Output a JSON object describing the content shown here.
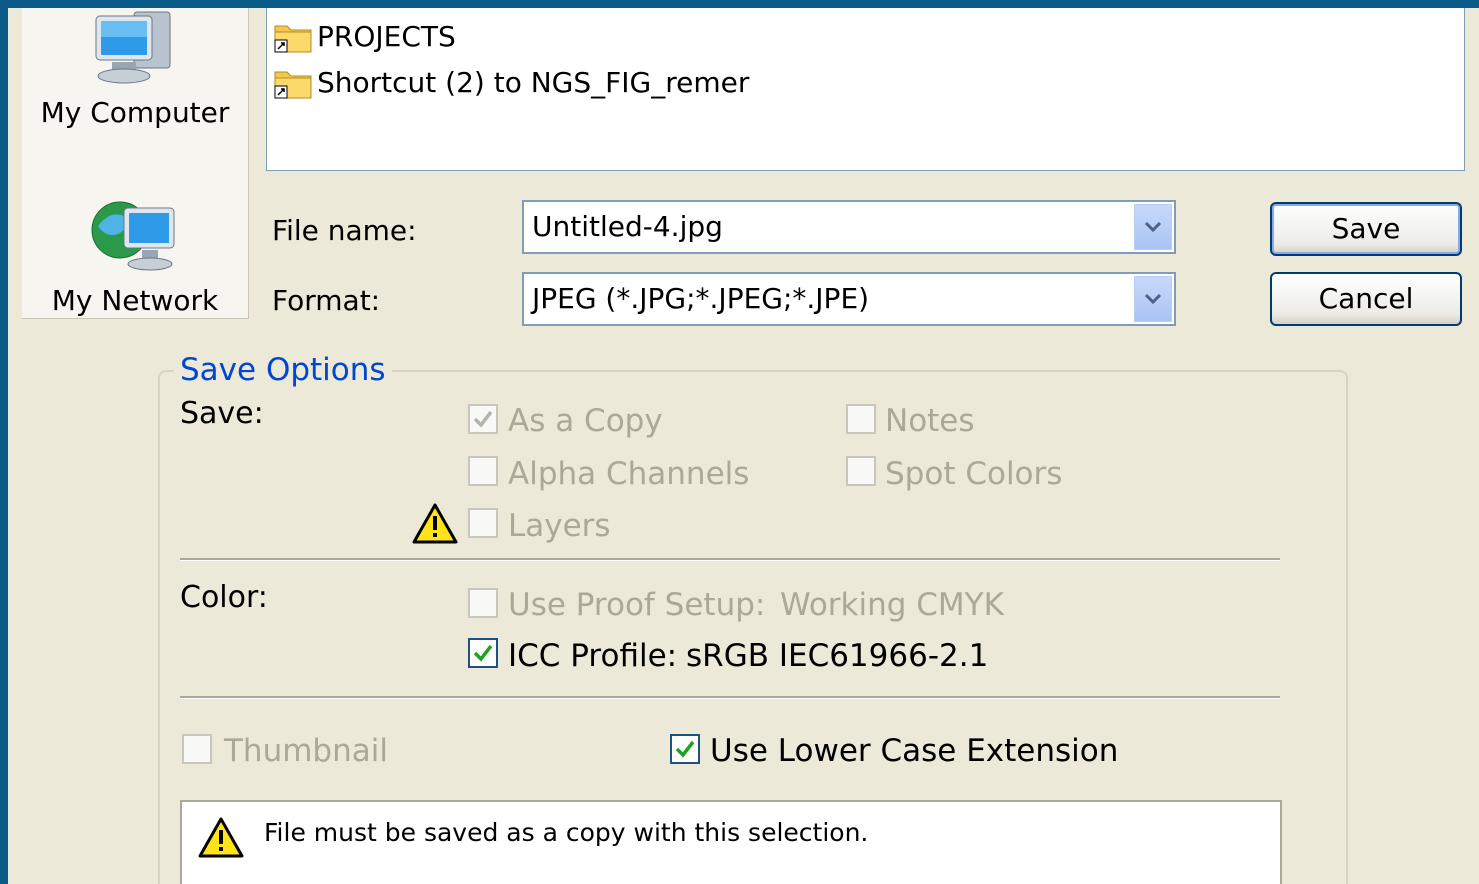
{
  "places": [
    {
      "label": "My Computer",
      "icon": "my-computer-icon"
    },
    {
      "label": "My Network",
      "icon": "my-network-icon"
    }
  ],
  "file_list": [
    {
      "name": "PROJECTS"
    },
    {
      "name": "Shortcut (2) to NGS_FIG_remer"
    }
  ],
  "file_name": {
    "label": "File name:",
    "value": "Untitled-4.jpg"
  },
  "format": {
    "label": "Format:",
    "value": "JPEG (*.JPG;*.JPEG;*.JPE)"
  },
  "buttons": {
    "save": "Save",
    "cancel": "Cancel"
  },
  "save_options": {
    "title": "Save Options",
    "save_label": "Save:",
    "as_a_copy": {
      "label": "As a Copy",
      "checked": true,
      "enabled": false
    },
    "notes": {
      "label": "Notes",
      "checked": false,
      "enabled": false
    },
    "alpha_channels": {
      "label": "Alpha Channels",
      "checked": false,
      "enabled": false
    },
    "spot_colors": {
      "label": "Spot Colors",
      "checked": false,
      "enabled": false
    },
    "layers": {
      "label": "Layers",
      "checked": false,
      "enabled": false
    },
    "color_label": "Color:",
    "use_proof_setup": {
      "label": "Use Proof Setup:",
      "value": "Working CMYK",
      "checked": false,
      "enabled": false
    },
    "icc_profile": {
      "label": "ICC Profile:",
      "value": "sRGB IEC61966-2.1",
      "checked": true,
      "enabled": true
    },
    "thumbnail": {
      "label": "Thumbnail",
      "checked": false,
      "enabled": false
    },
    "lower_case_ext": {
      "label": "Use Lower Case Extension",
      "checked": true,
      "enabled": true
    }
  },
  "warning_message": "File must be saved as a copy with this selection.",
  "colors": {
    "accent": "#0046d5",
    "titlebar": "#0a5a87",
    "dialog_bg": "#ece9d8"
  }
}
